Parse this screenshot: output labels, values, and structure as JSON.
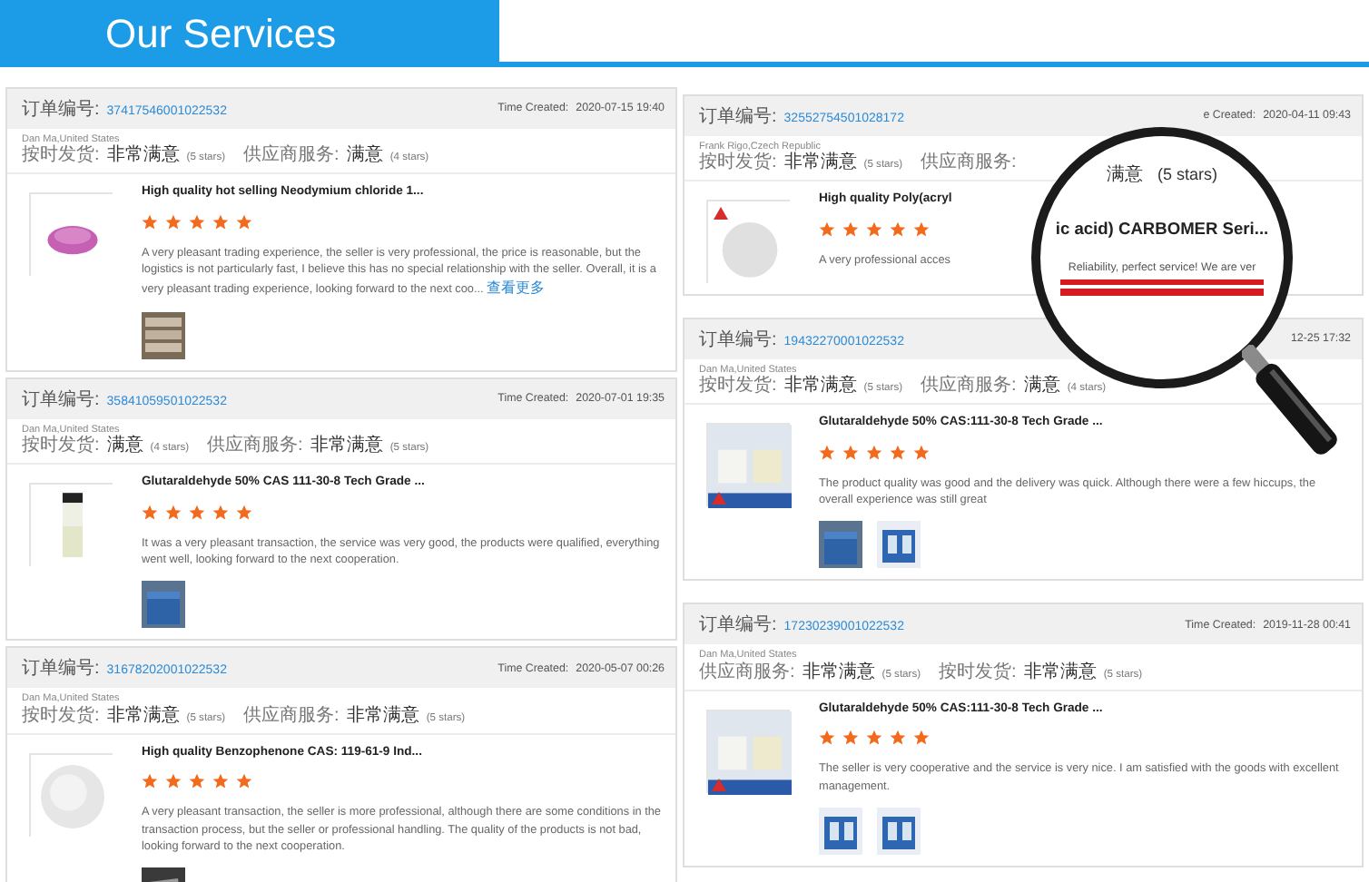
{
  "header": {
    "title": "Our Services"
  },
  "columns": [
    {
      "reviews": [
        {
          "order_label": "订单编号:",
          "order_no": "37417546001022532",
          "time_label": "Time Created:",
          "time": "2020-07-15 19:40",
          "buyer": "Dan Ma,United States",
          "ratings": [
            {
              "label": "按时发货:",
              "value": "非常满意",
              "note": "(5 stars)"
            },
            {
              "label": "供应商服务:",
              "value": "满意",
              "note": "(4 stars)"
            }
          ],
          "product": "High quality hot selling Neodymium chloride 1...",
          "stars": 5,
          "review": "A very pleasant trading experience, the seller is very professional, the price is reasonable, but the logistics is not particularly fast, I believe this has no special relationship with the seller. Overall, it is a very pleasant trading experience, looking forward to the next coo...",
          "more": "查看更多",
          "image": {
            "kind": "picture"
          },
          "photos": [
            {
              "kind": "picture"
            }
          ]
        },
        {
          "order_label": "订单编号:",
          "order_no": "35841059501022532",
          "time_label": "Time Created:",
          "time": "2020-07-01 19:35",
          "buyer": "Dan Ma,United States",
          "ratings": [
            {
              "label": "按时发货:",
              "value": "满意",
              "note": "(4 stars)"
            },
            {
              "label": "供应商服务:",
              "value": "非常满意",
              "note": "(5 stars)"
            }
          ],
          "product": "Glutaraldehyde 50% CAS 111-30-8 Tech Grade ...",
          "stars": 5,
          "review": "It was a very pleasant transaction, the service was very good, the products were qualified, everything went well, looking forward to the next cooperation.",
          "image": {
            "kind": "picture"
          },
          "photos": [
            {
              "kind": "picture"
            }
          ]
        },
        {
          "order_label": "订单编号:",
          "order_no": "31678202001022532",
          "time_label": "Time Created:",
          "time": "2020-05-07 00:26",
          "buyer": "Dan Ma,United States",
          "ratings": [
            {
              "label": "按时发货:",
              "value": "非常满意",
              "note": "(5 stars)"
            },
            {
              "label": "供应商服务:",
              "value": "非常满意",
              "note": "(5 stars)"
            }
          ],
          "product": "High quality Benzophenone CAS: 119-61-9 Ind...",
          "stars": 5,
          "review": "A very pleasant transaction, the seller is more professional, although there are some conditions in the transaction process, but the seller or professional handling. The quality of the products is not bad, looking forward to the next cooperation.",
          "image": {
            "kind": "picture"
          },
          "photos": [
            {
              "kind": "picture"
            }
          ]
        }
      ]
    },
    {
      "reviews": [
        {
          "order_label": "订单编号:",
          "order_no": "32552754501028172",
          "time_label": "e Created:",
          "time": "2020-04-11 09:43",
          "buyer": "Frank Rigo,Czech Republic",
          "ratings": [
            {
              "label": "按时发货:",
              "value": "非常满意",
              "note": "(5 stars)"
            },
            {
              "label": "供应商服务:"
            }
          ],
          "product": "High quality Poly(acryl",
          "stars": 5,
          "review": "A very professional acces",
          "image": {
            "kind": "picture"
          }
        },
        {
          "order_label": "订单编号:",
          "order_no": "19432270001022532",
          "time": "12-25 17:32",
          "buyer": "Dan Ma,United States",
          "ratings": [
            {
              "label": "按时发货:",
              "value": "非常满意",
              "note": "(5 stars)"
            },
            {
              "label": "供应商服务:",
              "value": "满意",
              "note": "(4 stars)"
            }
          ],
          "product": "Glutaraldehyde 50% CAS:111-30-8 Tech Grade ...",
          "stars": 5,
          "review": "The product quality was good and the delivery was quick. Although there were a few hiccups, the overall experience was still great",
          "image": {
            "kind": "picture"
          },
          "photos": [
            {
              "kind": "picture"
            },
            {
              "kind": "picture"
            }
          ]
        },
        {
          "order_label": "订单编号:",
          "order_no": "17230239001022532",
          "time_label": "Time Created:",
          "time": "2019-11-28 00:41",
          "buyer": "Dan Ma,United States",
          "ratings": [
            {
              "label": "供应商服务:",
              "value": "非常满意",
              "note": "(5 stars)"
            },
            {
              "label": "按时发货:",
              "value": "非常满意",
              "note": "(5 stars)"
            }
          ],
          "product": "Glutaraldehyde 50% CAS:111-30-8 Tech Grade ...",
          "stars": 5,
          "review": "The seller is very cooperative and the service is very nice. I am satisfied with the goods with excellent management.",
          "image": {
            "kind": "picture"
          },
          "photos": [
            {
              "kind": "picture"
            },
            {
              "kind": "picture"
            }
          ]
        }
      ]
    }
  ],
  "magnifier": {
    "rating_value": "满意",
    "rating_note": "(5 stars)",
    "title": "ic acid) CARBOMER Seri...",
    "review": "Reliability, perfect service! We are ver"
  }
}
